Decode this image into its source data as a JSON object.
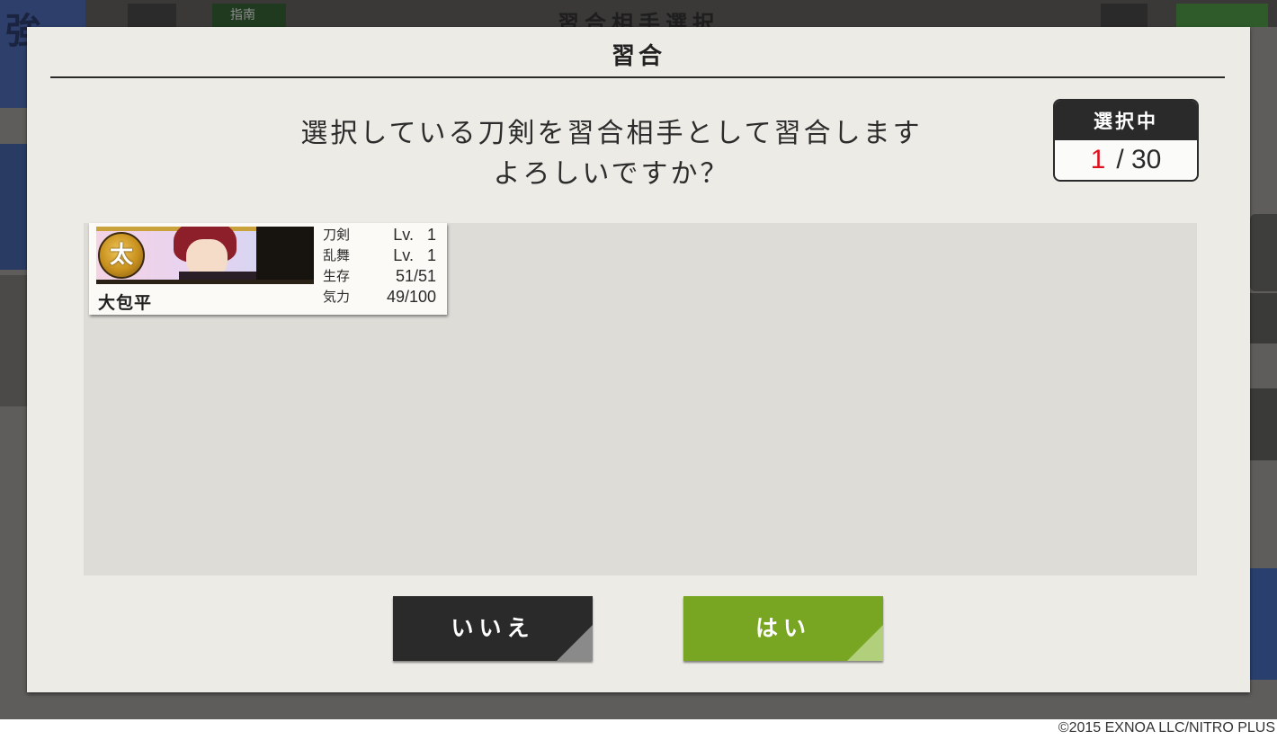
{
  "background": {
    "screen_title": "習合相手選択",
    "corner_glyph": "強",
    "guide_label": "指南"
  },
  "dialog": {
    "title": "習合",
    "message_line1": "選択している刀剣を習合相手として習合します",
    "message_line2": "よろしいですか？",
    "counter": {
      "label": "選択中",
      "current": "1",
      "separator_total": "/ 30"
    }
  },
  "selected_swords": [
    {
      "name": "大包平",
      "type_badge": "太",
      "stats": [
        {
          "label": "刀剣",
          "value": "Lv.   1"
        },
        {
          "label": "乱舞",
          "value": "Lv.   1"
        },
        {
          "label": "生存",
          "value": "51/51"
        },
        {
          "label": "気力",
          "value": "49/100"
        }
      ]
    }
  ],
  "buttons": {
    "no_label": "いいえ",
    "yes_label": "はい"
  },
  "colors": {
    "yes_button": "#78a622",
    "no_button": "#2a2a2a",
    "counter_current": "#e0121f"
  },
  "copyright": "©2015 EXNOA LLC/NITRO PLUS"
}
